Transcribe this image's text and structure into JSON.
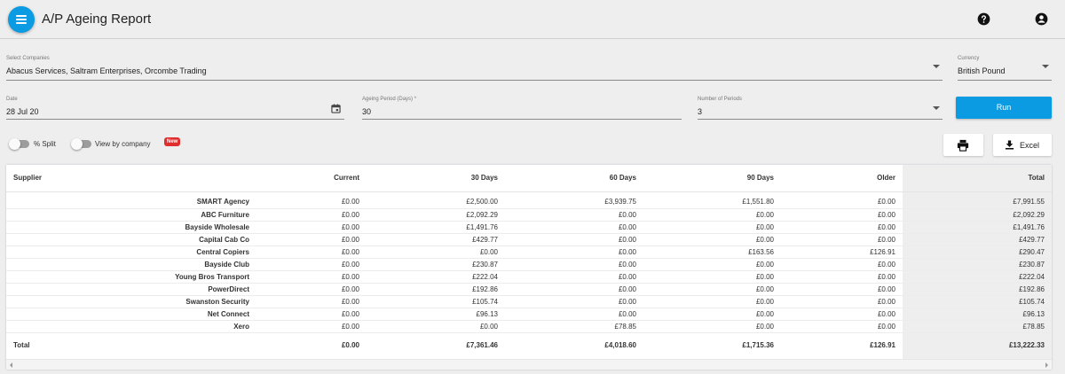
{
  "header": {
    "title": "A/P Ageing Report"
  },
  "filters": {
    "companies_label": "Select Companies",
    "companies_value": "Abacus Services, Saltram Enterprises, Orcombe Trading",
    "currency_label": "Currency",
    "currency_value": "British Pound",
    "date_label": "Date",
    "date_value": "28 Jul 20",
    "period_label": "Ageing Period (Days) *",
    "period_value": "30",
    "num_periods_label": "Number of Periods",
    "num_periods_value": "3",
    "run_label": "Run"
  },
  "toggles": {
    "split_label": "% Split",
    "by_company_label": "View by company",
    "new_badge": "New"
  },
  "actions": {
    "excel_label": "Excel"
  },
  "table": {
    "columns": [
      "Supplier",
      "Current",
      "30 Days",
      "60 Days",
      "90 Days",
      "Older",
      "Total"
    ],
    "rows": [
      [
        "SMART Agency",
        "£0.00",
        "£2,500.00",
        "£3,939.75",
        "£1,551.80",
        "£0.00",
        "£7,991.55"
      ],
      [
        "ABC Furniture",
        "£0.00",
        "£2,092.29",
        "£0.00",
        "£0.00",
        "£0.00",
        "£2,092.29"
      ],
      [
        "Bayside Wholesale",
        "£0.00",
        "£1,491.76",
        "£0.00",
        "£0.00",
        "£0.00",
        "£1,491.76"
      ],
      [
        "Capital Cab Co",
        "£0.00",
        "£429.77",
        "£0.00",
        "£0.00",
        "£0.00",
        "£429.77"
      ],
      [
        "Central Copiers",
        "£0.00",
        "£0.00",
        "£0.00",
        "£163.56",
        "£126.91",
        "£290.47"
      ],
      [
        "Bayside Club",
        "£0.00",
        "£230.87",
        "£0.00",
        "£0.00",
        "£0.00",
        "£230.87"
      ],
      [
        "Young Bros Transport",
        "£0.00",
        "£222.04",
        "£0.00",
        "£0.00",
        "£0.00",
        "£222.04"
      ],
      [
        "PowerDirect",
        "£0.00",
        "£192.86",
        "£0.00",
        "£0.00",
        "£0.00",
        "£192.86"
      ],
      [
        "Swanston Security",
        "£0.00",
        "£105.74",
        "£0.00",
        "£0.00",
        "£0.00",
        "£105.74"
      ],
      [
        "Net Connect",
        "£0.00",
        "£96.13",
        "£0.00",
        "£0.00",
        "£0.00",
        "£96.13"
      ],
      [
        "Xero",
        "£0.00",
        "£0.00",
        "£78.85",
        "£0.00",
        "£0.00",
        "£78.85"
      ]
    ],
    "total_row": [
      "Total",
      "£0.00",
      "£7,361.46",
      "£4,018.60",
      "£1,715.36",
      "£126.91",
      "£13,222.33"
    ]
  },
  "colors": {
    "accent": "#0a9be2",
    "badge": "#e02e2e"
  },
  "icons": [
    "menu-icon",
    "help-icon",
    "account-icon",
    "calendar-icon",
    "print-icon",
    "download-icon"
  ]
}
